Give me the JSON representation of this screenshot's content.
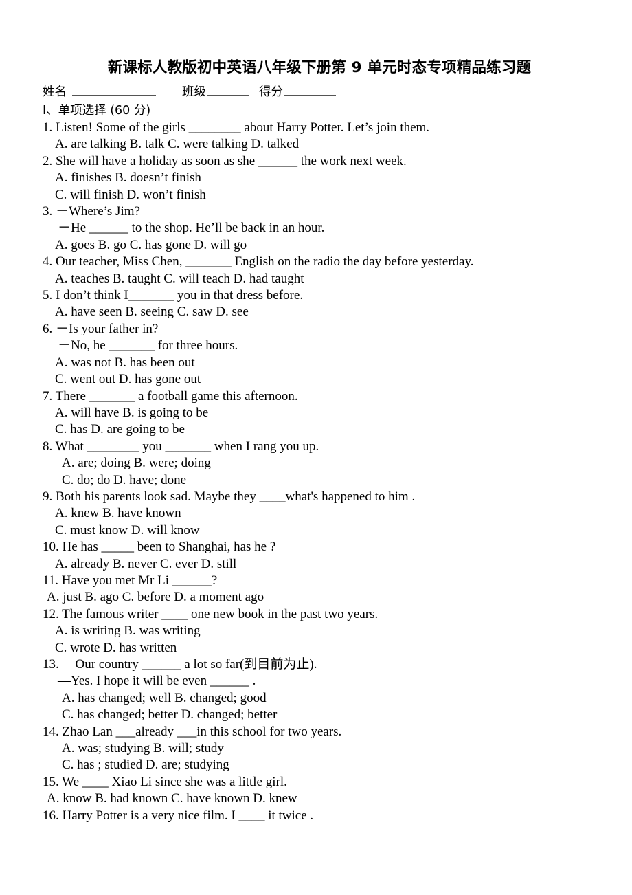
{
  "document": {
    "title": "新课标人教版初中英语八年级下册第 9 单元时态专项精品练习题",
    "info": {
      "name_label": "姓名",
      "class_label": "班级",
      "score_label": "得分"
    },
    "section_heading": "I、单项选择 (60 分)"
  },
  "questions": [
    {
      "number": "1.",
      "stem": "1. Listen! Some of the girls ________ about Harry Potter. Let’s join them.",
      "dash_lines": [],
      "option_lines": [
        "A. are talking   B. talk   C. were talking   D. talked"
      ],
      "option_indent": "q-opts"
    },
    {
      "number": "2.",
      "stem": "2. She will have a holiday as soon as she ______ the work next week.",
      "dash_lines": [],
      "option_lines": [
        "A. finishes             B. doesn’t finish",
        "C. will finish        D. won’t finish"
      ],
      "option_indent": "q-opts"
    },
    {
      "number": "3.",
      "stem": "3.  －Where’s Jim?",
      "dash_lines": [
        "－He ______ to the shop. He’ll be back in an hour."
      ],
      "option_lines": [
        "A. goes    B. go       C. has gone   D. will go"
      ],
      "option_indent": "q-opts"
    },
    {
      "number": "4.",
      "stem": "4. Our teacher, Miss Chen, _______ English on the radio the day before yesterday.",
      "dash_lines": [],
      "option_lines": [
        "A. teaches   B. taught   C. will teach    D. had taught"
      ],
      "option_indent": "q-opts"
    },
    {
      "number": "5.",
      "stem": "5. I don’t think I_______ you in that dress before.",
      "dash_lines": [],
      "option_lines": [
        "A. have seen   B. seeing    C. saw   D. see"
      ],
      "option_indent": "q-opts"
    },
    {
      "number": "6.",
      "stem": "6.  －Is your father in?",
      "dash_lines": [
        "－No, he _______ for three hours."
      ],
      "option_lines": [
        "A. was not        B. has been out",
        "C. went out       D. has gone out"
      ],
      "option_indent": "q-opts"
    },
    {
      "number": "7.",
      "stem": "7. There _______ a football game this afternoon.",
      "dash_lines": [],
      "option_lines": [
        "A. will have   B. is going to be",
        "C. has                D. are going to be"
      ],
      "option_indent": "q-opts"
    },
    {
      "number": "8.",
      "stem": "8. What ________ you _______ when I rang you up.",
      "dash_lines": [],
      "option_lines": [
        "A. are; doing            B. were; doing",
        "C. do; do               D. have; done"
      ],
      "option_indent": "q-opts-2"
    },
    {
      "number": "9.",
      "stem": "9. Both his parents look sad. Maybe they ____what's happened to him .",
      "dash_lines": [],
      "option_lines": [
        "A. knew                B. have known",
        "C. must know          D. will know"
      ],
      "option_indent": "q-opts"
    },
    {
      "number": "10.",
      "stem": "10. He has _____ been to Shanghai, has he ?",
      "dash_lines": [],
      "option_lines": [
        "A. already   B. never       C. ever     D. still"
      ],
      "option_indent": "q-opts"
    },
    {
      "number": "11.",
      "stem": "11. Have you met Mr Li ______?",
      "dash_lines": [],
      "option_lines": [
        "A. just    B. ago       C. before   D. a moment ago"
      ],
      "option_indent": "q-opts-0"
    },
    {
      "number": "12.",
      "stem": "12. The famous writer ____ one new book in the past two years.",
      "dash_lines": [],
      "option_lines": [
        "A. is writing            B. was writing",
        "C. wrote             D. has written"
      ],
      "option_indent": "q-opts"
    },
    {
      "number": "13.",
      "stem": "13. —Our country ______ a lot so far(到目前为止).",
      "dash_lines": [
        "—Yes. I hope it will be even ______ ."
      ],
      "option_lines": [
        "A. has changed; well           B. changed; good",
        "C. has changed; better          D. changed; better"
      ],
      "option_indent": "q-opts-2"
    },
    {
      "number": "14.",
      "stem": "14. Zhao Lan ___already ___in this school for two years.",
      "dash_lines": [],
      "option_lines": [
        "A. was; studying       B. will; study",
        "C. has ; studied        D. are; studying"
      ],
      "option_indent": "q-opts-2"
    },
    {
      "number": "15.",
      "stem": "15. We ____ Xiao Li since she was a little girl.",
      "dash_lines": [],
      "option_lines": [
        "A. know    B. had known   C. have known   D. knew"
      ],
      "option_indent": "q-opts-0"
    },
    {
      "number": "16.",
      "stem": "16. Harry Potter is a very nice film. I ____ it twice .",
      "dash_lines": [],
      "option_lines": [],
      "option_indent": "q-opts"
    }
  ]
}
